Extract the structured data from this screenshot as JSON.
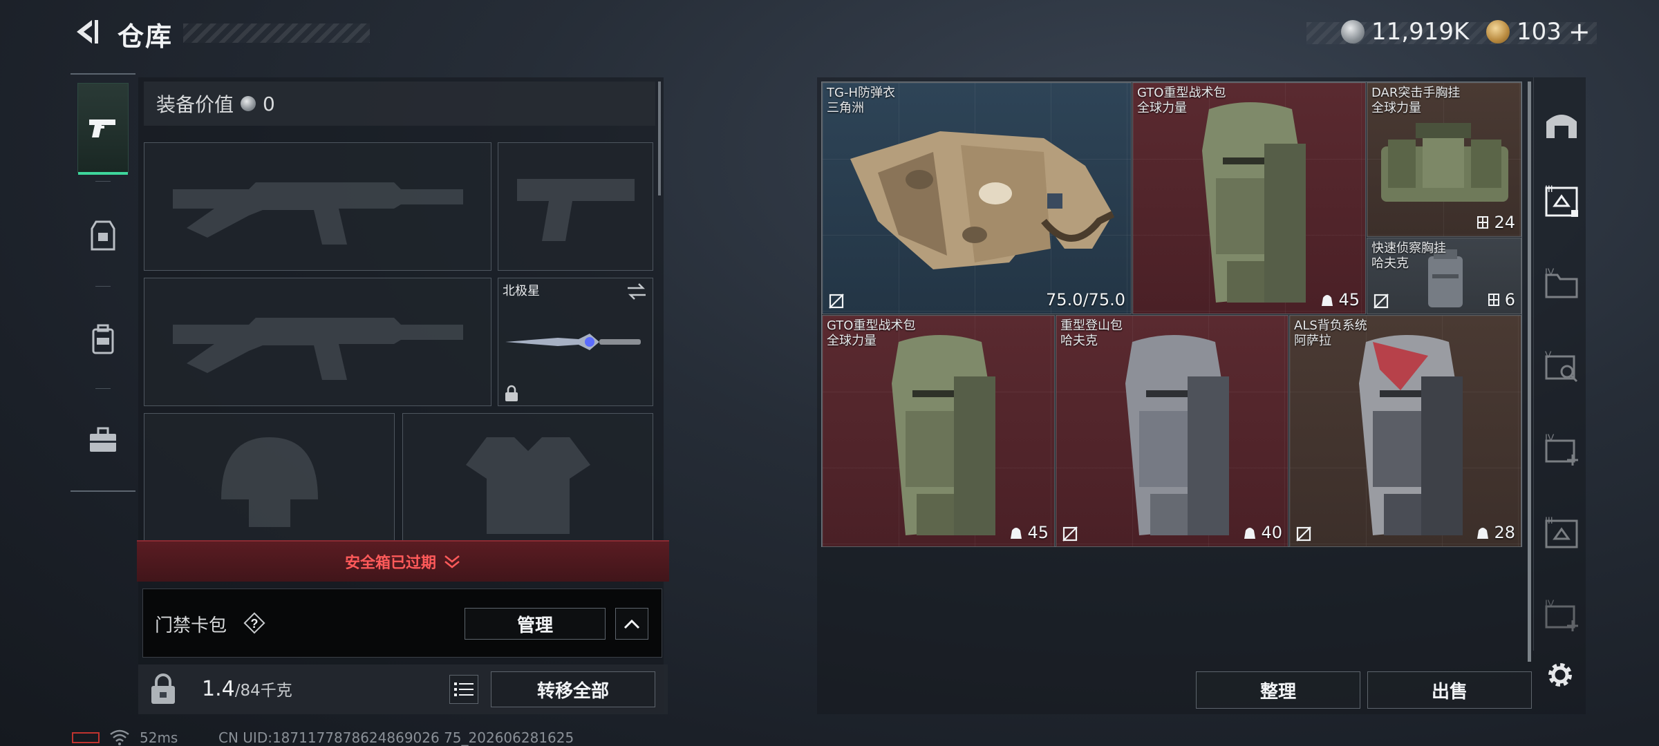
{
  "header": {
    "title": "仓库",
    "currency1": "11,919K",
    "currency2": "103",
    "currency2_plus": "+"
  },
  "equipment": {
    "value_label": "装备价值",
    "value": "0",
    "melee_name": "北极星"
  },
  "safebox": {
    "label": "安全箱已过期"
  },
  "cardpack": {
    "label": "门禁卡包",
    "help": "?",
    "manage": "管理"
  },
  "footer_left": {
    "weight_current": "1.4",
    "weight_max": "/84千克",
    "transfer_all": "转移全部"
  },
  "status": {
    "ping": "52ms",
    "uid": "CN UID:1871177878624869026 75_202606281625"
  },
  "items": [
    {
      "name": "TG-H防弹衣",
      "sub": "三角洲",
      "stat": "75.0/75.0",
      "color": "blue"
    },
    {
      "name": "GTO重型战术包",
      "sub": "全球力量",
      "stat": "45",
      "color": "red"
    },
    {
      "name": "DAR突击手胸挂",
      "sub": "全球力量",
      "stat": "24",
      "color": "brown"
    },
    {
      "name": "快速侦察胸挂",
      "sub": "哈夫克",
      "stat": "6",
      "color": "gray"
    },
    {
      "name": "GTO重型战术包",
      "sub": "全球力量",
      "stat": "45",
      "color": "red"
    },
    {
      "name": "重型登山包",
      "sub": "哈夫克",
      "stat": "40",
      "color": "red"
    },
    {
      "name": "ALS背负系统",
      "sub": "阿萨拉",
      "stat": "28",
      "color": "brown"
    }
  ],
  "footer_right": {
    "sort": "整理",
    "sell": "出售"
  },
  "right_tab_labels": [
    "III",
    "IV",
    "V",
    "IV",
    "III",
    "IV"
  ],
  "colors": {
    "accent_green": "#3ed69c",
    "safebox_red": "#ff5a5a",
    "blue_item": "#2e4457",
    "red_item": "#5a2a30",
    "brown_item": "#4a3a33"
  }
}
